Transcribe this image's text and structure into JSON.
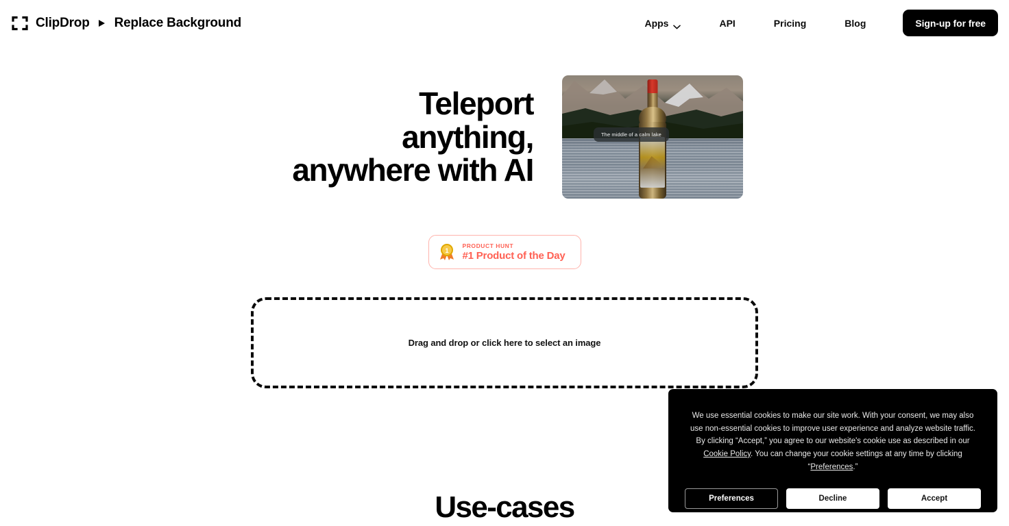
{
  "header": {
    "logo_icon": "clipdrop-frame-icon",
    "brand_name": "ClipDrop",
    "separator_icon": "play-triangle-icon",
    "page_name": "Replace Background",
    "nav": [
      {
        "label": "Apps",
        "icon": "chevron-down-icon",
        "has_chevron": true
      },
      {
        "label": "API",
        "has_chevron": false
      },
      {
        "label": "Pricing",
        "has_chevron": false
      },
      {
        "label": "Blog",
        "has_chevron": false
      }
    ],
    "signup_label": "Sign-up for free"
  },
  "hero": {
    "headline_lines": [
      "Teleport",
      "anything,",
      "anywhere with AI"
    ],
    "image": {
      "alt": "Wine bottle composited onto a mountain lake background",
      "caption": "The middle of a calm lake"
    }
  },
  "product_hunt": {
    "icon": "medal-icon",
    "medal_number": "1",
    "kicker": "PRODUCT HUNT",
    "title": "#1 Product of the Day"
  },
  "dropzone": {
    "label": "Drag and drop or click here to select an image"
  },
  "sections": {
    "use_cases_title": "Use-cases"
  },
  "cookie_banner": {
    "text_part1": "We use essential cookies to make our site work. With your consent, we may also use non-essential cookies to improve user experience and analyze website traffic. By clicking “Accept,” you agree to our website's cookie use as described in our ",
    "link_cookie_policy": "Cookie Policy",
    "text_part2": ". You can change your cookie settings at any time by clicking “",
    "link_preferences": "Preferences",
    "text_part3": ".”",
    "buttons": {
      "preferences": "Preferences",
      "decline": "Decline",
      "accept": "Accept"
    }
  },
  "colors": {
    "accent_product_hunt": "#FF6154",
    "product_hunt_border": "#FFB3AC",
    "brand_black": "#000000",
    "page_background": "#FFFFFF",
    "banner_background": "#000000",
    "medal_gold": "#F5C518"
  }
}
